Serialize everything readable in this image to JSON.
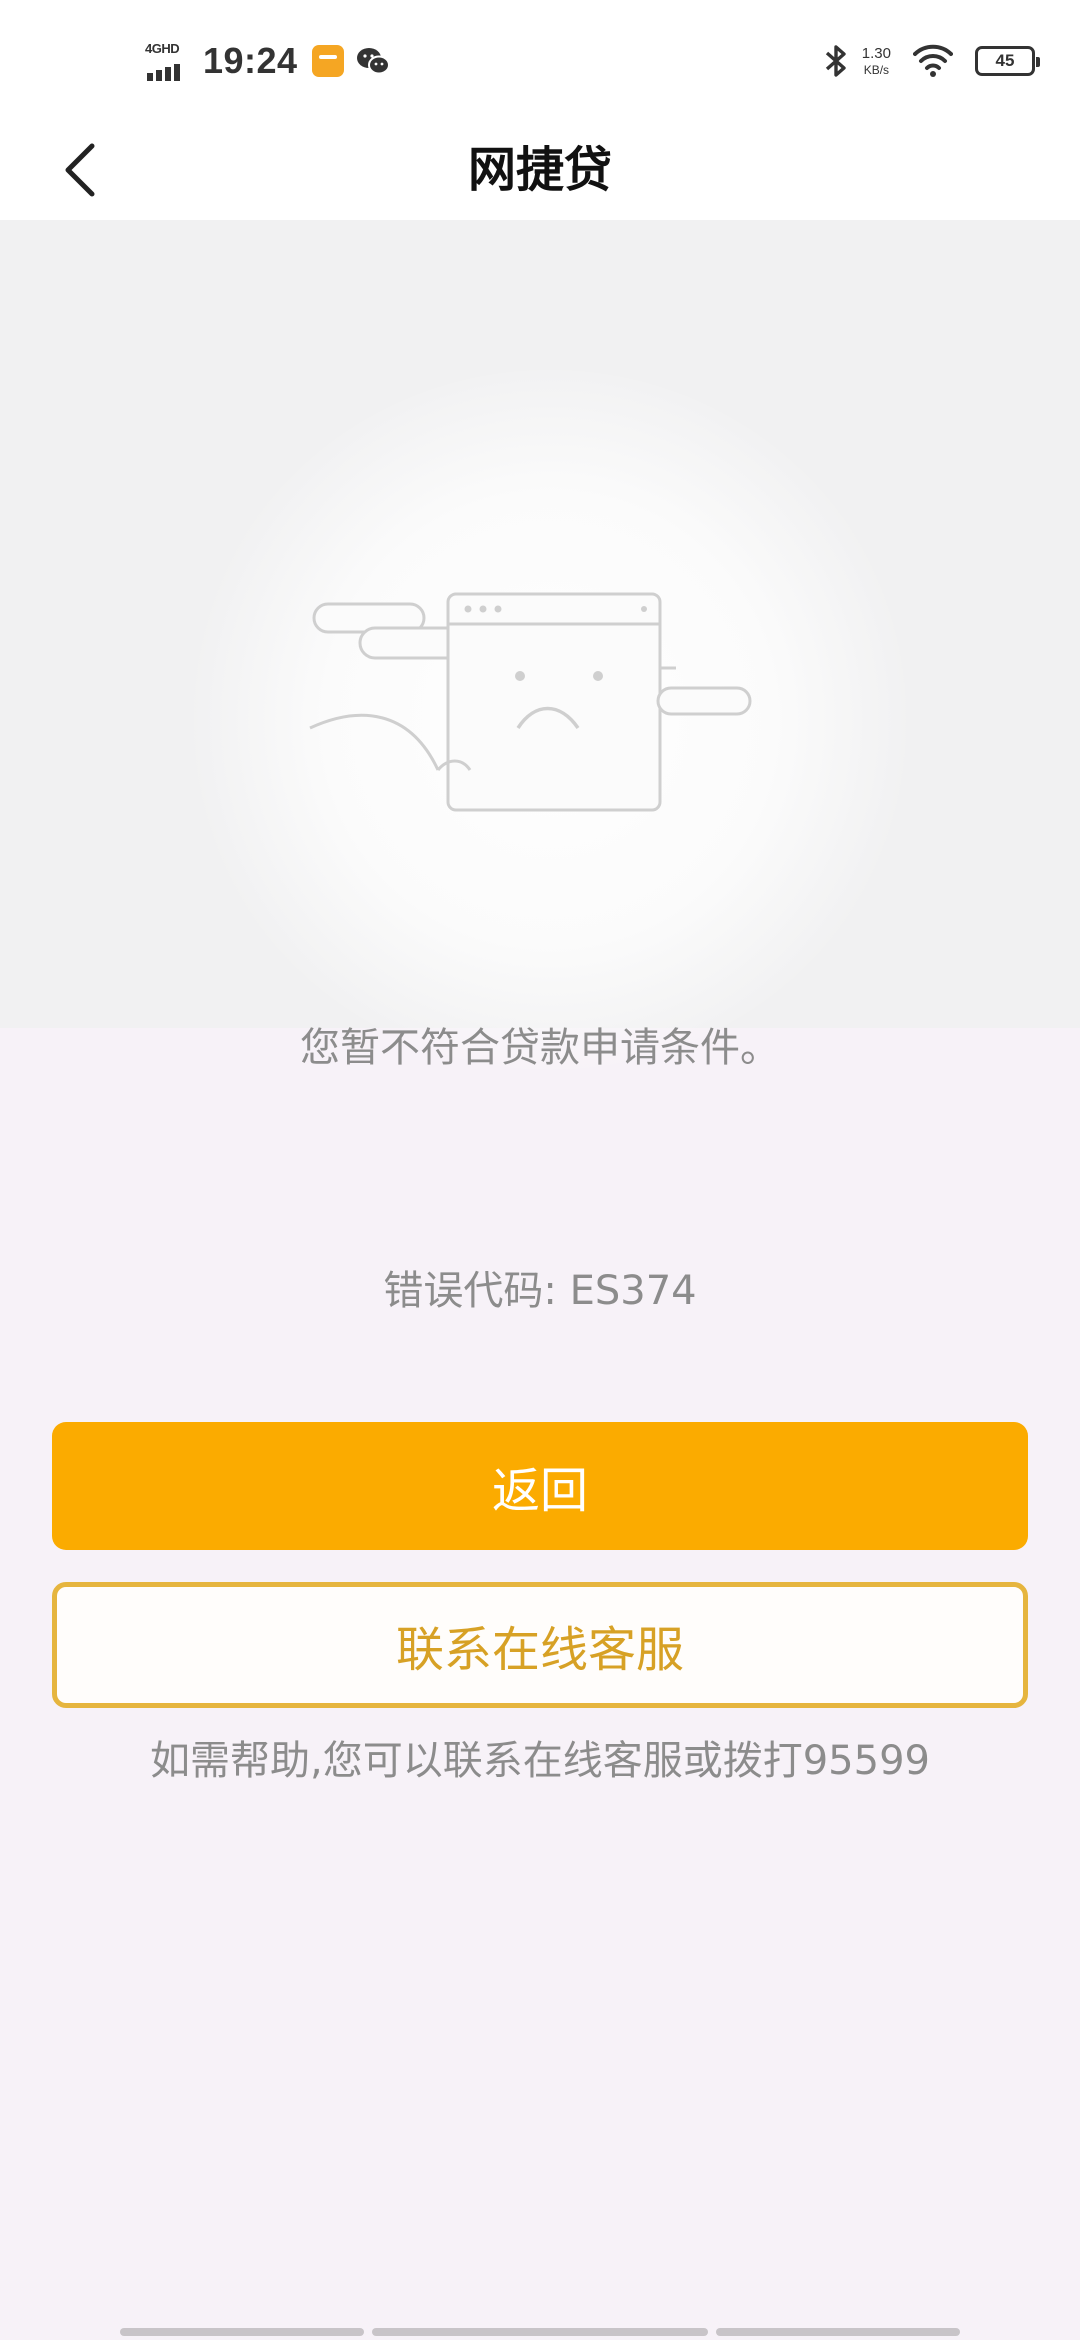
{
  "status_bar": {
    "network_type": "4GHD",
    "time": "19:24",
    "speed_value": "1.30",
    "speed_unit": "KB/s",
    "battery_level": "45",
    "icons": [
      "signal-icon",
      "app-notification-icon",
      "wechat-icon",
      "bluetooth-icon",
      "wifi-icon",
      "battery-icon"
    ]
  },
  "header": {
    "title": "网捷贷",
    "back_icon": "chevron-left-icon"
  },
  "main": {
    "illustration": "sad-window-icon",
    "message": "您暂不符合贷款申请条件。",
    "error_code": "错误代码: ES374",
    "primary_button_label": "返回",
    "secondary_button_label": "联系在线客服",
    "help_text": "如需帮助,您可以联系在线客服或拨打95599"
  },
  "colors": {
    "accent": "#fbab00",
    "secondary_border": "#e6b53e",
    "secondary_text": "#d7a125",
    "muted_text": "#8c8c8c",
    "background": "#f7f2f8"
  }
}
